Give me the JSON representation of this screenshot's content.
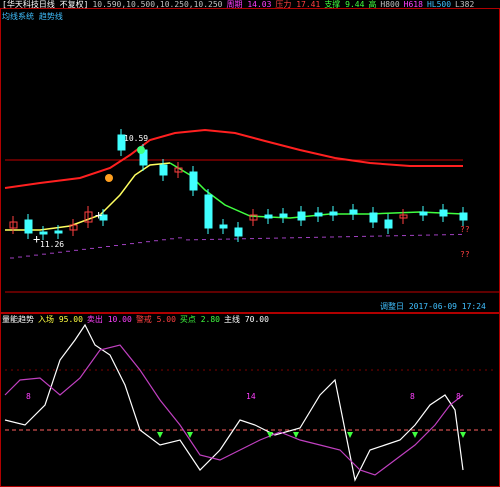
{
  "main_panel": {
    "header_items": [
      {
        "text": "[华天科技日线 不复权]",
        "color": "#ffffff"
      },
      {
        "text": "10.590,10.500,10.250,10.250",
        "color": "#c0c0c0"
      },
      {
        "text": "周期 14.03",
        "color": "#ff40ff"
      },
      {
        "text": "压力 17.41",
        "color": "#ff4040"
      },
      {
        "text": "支撑 9.44",
        "color": "#40ff40"
      },
      {
        "text": "高",
        "color": "#40ff40"
      },
      {
        "text": "H800",
        "color": "#c0c0c0"
      },
      {
        "text": "H618",
        "color": "#ff40ff"
      },
      {
        "text": "HL500",
        "color": "#40c0ff"
      },
      {
        "text": "L382",
        "color": "#c0c0c0"
      }
    ],
    "sub_header": "均线系统 趋势线",
    "sub_header_color": "#40c0ff",
    "high_label": "10.59",
    "low_label": "11.26",
    "right_marks": [
      "??",
      "??"
    ],
    "bottom_status": "调整日 2017-06-09 17:24",
    "crosshair_symbol": "+"
  },
  "indicator_panel": {
    "header_items": [
      {
        "text": "量能趋势",
        "color": "#ffffff"
      },
      {
        "text": "入场 95.00",
        "color": "#ffff40"
      },
      {
        "text": "卖出 10.00",
        "color": "#ff40ff"
      },
      {
        "text": "警戒 5.00",
        "color": "#ff4040"
      },
      {
        "text": "买点 2.80",
        "color": "#40ff40"
      },
      {
        "text": "主线 70.00",
        "color": "#ffffff"
      }
    ],
    "badge_labels": [
      "8",
      "14",
      "8",
      "8"
    ]
  },
  "colors": {
    "border": "#b00000",
    "up_candle": "#40ffff",
    "down_candle": "#ff4040",
    "upper_curve": "#ff2020",
    "mid_curve": "#40ff40",
    "white_line": "#ffffff",
    "magenta_line": "#c040c0",
    "dashed_line": "#ff6060"
  }
}
